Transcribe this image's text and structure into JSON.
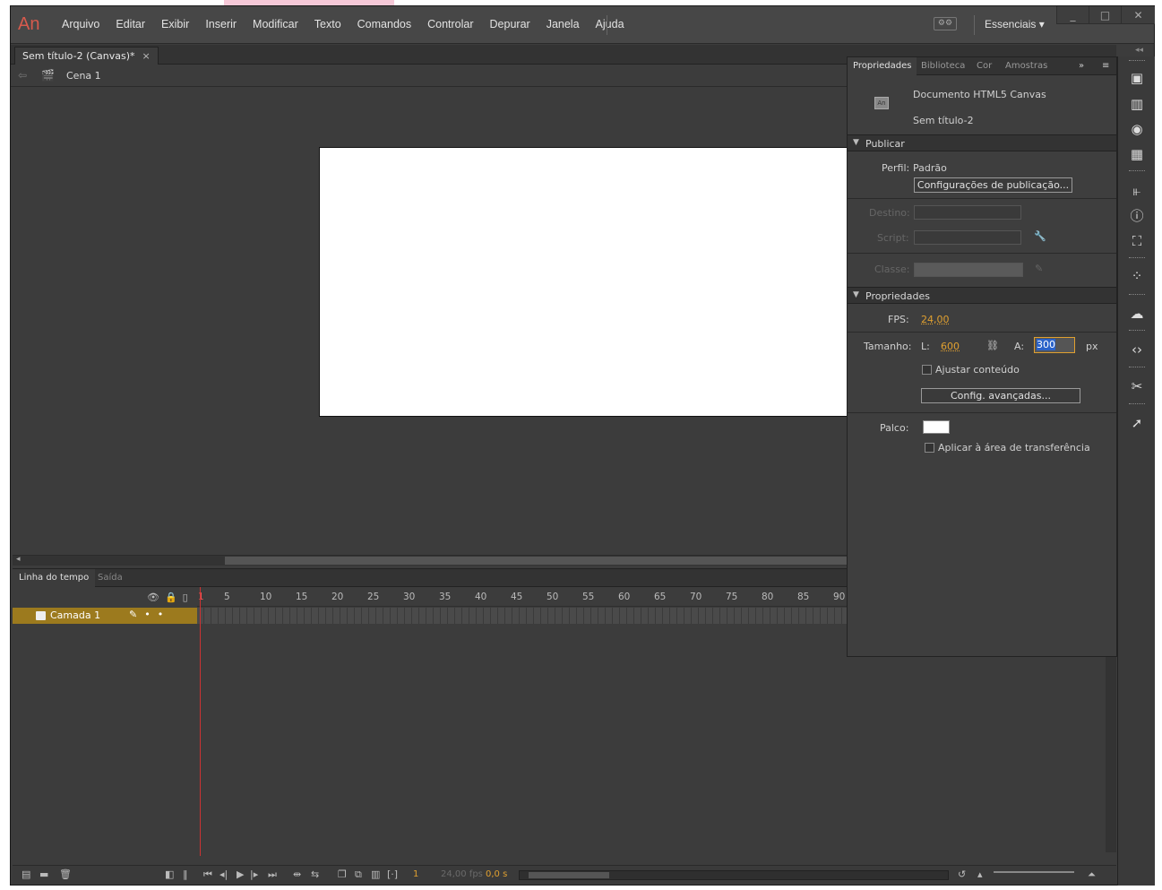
{
  "app": {
    "logo": "An",
    "menu": [
      "Arquivo",
      "Editar",
      "Exibir",
      "Inserir",
      "Modificar",
      "Texto",
      "Comandos",
      "Controlar",
      "Depurar",
      "Janela",
      "Ajuda"
    ],
    "workspace": "Essenciais",
    "window_controls": {
      "minimize": "_",
      "restore": "□",
      "close": "✕"
    }
  },
  "document": {
    "tab_title": "Sem título-2 (Canvas)*",
    "tab_close": "×",
    "scene": "Cena 1",
    "stage": {
      "width": 600,
      "height": 300,
      "color": "#ffffff"
    }
  },
  "timeline": {
    "tabs": [
      "Linha do tempo",
      "Saída"
    ],
    "ruler": [
      "1",
      "5",
      "10",
      "15",
      "20",
      "25",
      "30",
      "35",
      "40",
      "45",
      "50",
      "55",
      "60",
      "65",
      "70",
      "75",
      "80",
      "85",
      "90"
    ],
    "layer": {
      "name": "Camada 1"
    },
    "status": {
      "frame": "1",
      "fps": "24,00 fps",
      "time": "0,0 s"
    }
  },
  "properties": {
    "tabs": [
      "Propriedades",
      "Biblioteca",
      "Cor",
      "Amostras"
    ],
    "doc_type": "Documento HTML5 Canvas",
    "doc_name": "Sem título-2",
    "doc_icon": "An",
    "publish": {
      "section": "Publicar",
      "profile_label": "Perfil:",
      "profile_value": "Padrão",
      "settings_button": "Configurações de publicação...",
      "target_label": "Destino:",
      "script_label": "Script:",
      "class_label": "Classe:"
    },
    "props": {
      "section": "Propriedades",
      "fps_label": "FPS:",
      "fps_value": "24,00",
      "size_label": "Tamanho:",
      "w_label": "L:",
      "w_value": "600",
      "h_label": "A:",
      "h_value": "300",
      "unit": "px",
      "fit_content": "Ajustar conteúdo",
      "advanced_button": "Config. avançadas...",
      "stage_label": "Palco:",
      "stage_color": "#ffffff",
      "clipboard": "Aplicar à área de transferência"
    }
  },
  "colors": {
    "accent": "#e0a030",
    "layer": "#9c7a1e",
    "playhead": "#cc3333"
  }
}
